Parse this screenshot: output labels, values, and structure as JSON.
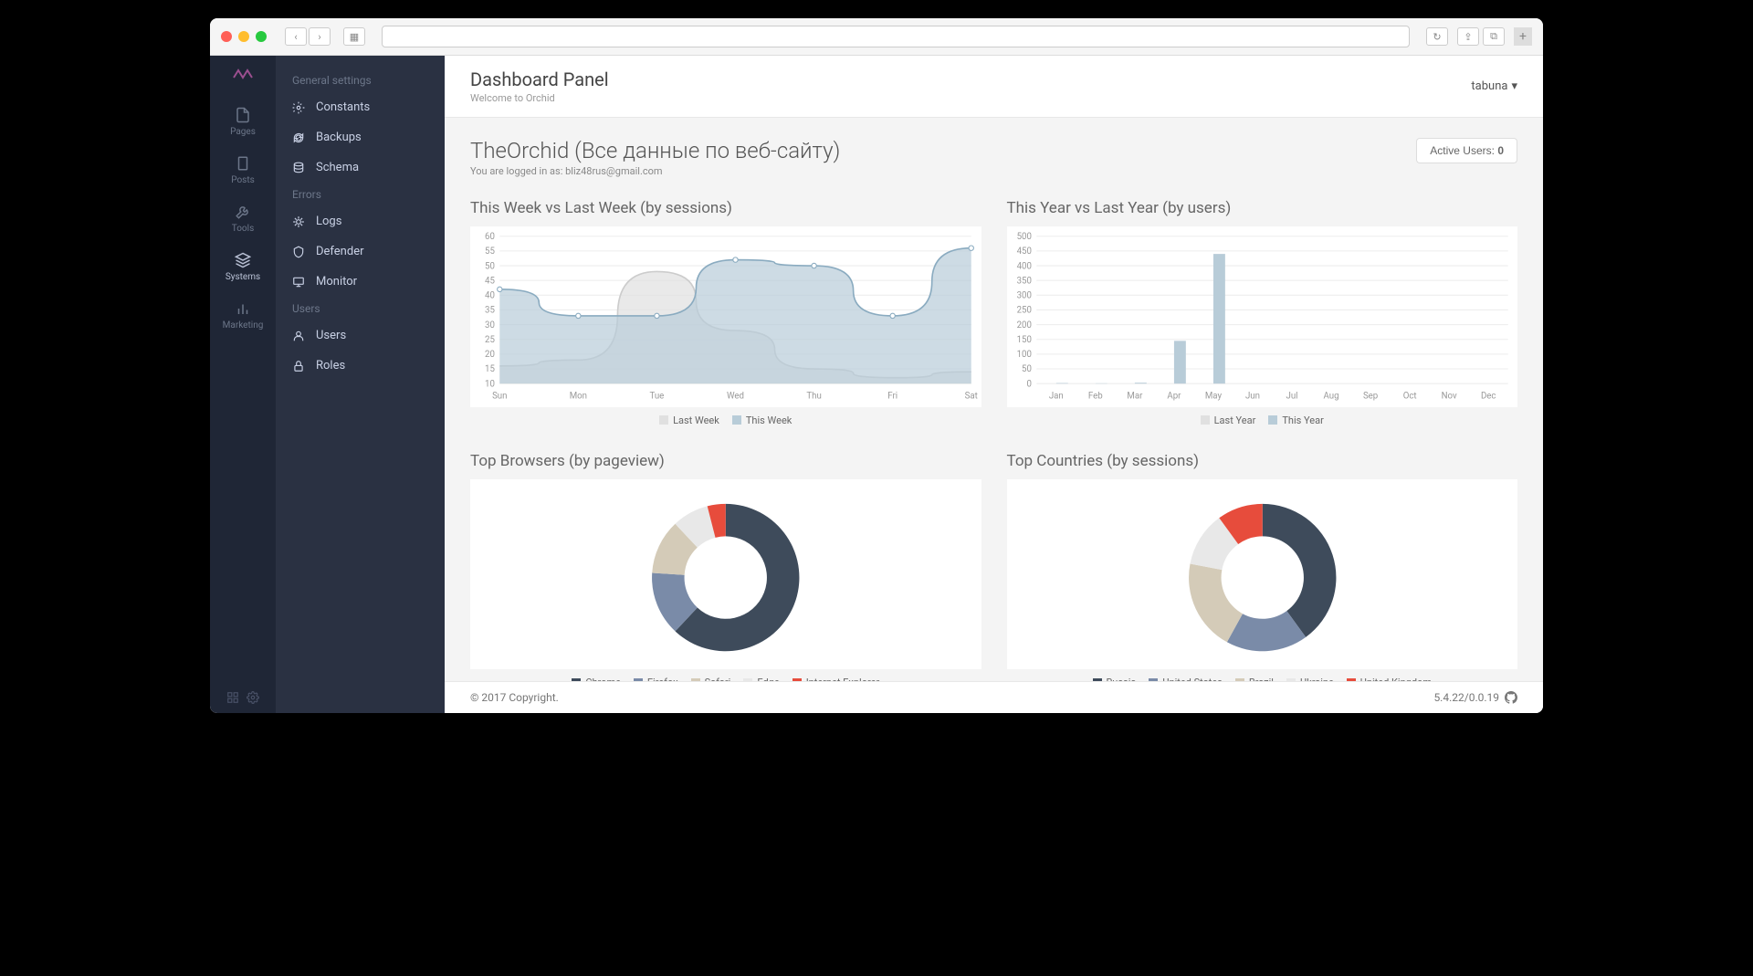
{
  "header": {
    "title": "Dashboard Panel",
    "subtitle": "Welcome to Orchid",
    "user": "tabuna"
  },
  "sidebar_dark": {
    "items": [
      {
        "id": "pages",
        "label": "Pages"
      },
      {
        "id": "posts",
        "label": "Posts"
      },
      {
        "id": "tools",
        "label": "Tools"
      },
      {
        "id": "systems",
        "label": "Systems",
        "active": true
      },
      {
        "id": "marketing",
        "label": "Marketing"
      }
    ]
  },
  "sidebar_sub": {
    "groups": [
      {
        "header": "General settings",
        "items": [
          {
            "icon": "gear",
            "label": "Constants"
          },
          {
            "icon": "refresh",
            "label": "Backups"
          },
          {
            "icon": "database",
            "label": "Schema"
          }
        ]
      },
      {
        "header": "Errors",
        "items": [
          {
            "icon": "bug",
            "label": "Logs"
          },
          {
            "icon": "shield",
            "label": "Defender"
          },
          {
            "icon": "monitor",
            "label": "Monitor"
          }
        ]
      },
      {
        "header": "Users",
        "items": [
          {
            "icon": "user",
            "label": "Users"
          },
          {
            "icon": "lock",
            "label": "Roles"
          }
        ]
      }
    ]
  },
  "page": {
    "title": "TheOrchid (Все данные по веб-сайту)",
    "subtitle": "You are logged in as: bliz48rus@gmail.com",
    "active_users_label": "Active Users:",
    "active_users_count": "0"
  },
  "footer": {
    "copyright": "© 2017 Copyright.",
    "version": "5.4.22/0.0.19"
  },
  "colors": {
    "dark_slate": "#3e4b5b",
    "blue_gray": "#7a8ba8",
    "beige": "#d4cbb8",
    "light_gray": "#e8e8e8",
    "red": "#e74c3c",
    "area_fill": "#b8ccd8",
    "area_line": "#8aabc0",
    "area2_fill": "#e0e0e0"
  },
  "chart_data": [
    {
      "id": "weekly",
      "type": "area",
      "title": "This Week vs Last Week (by sessions)",
      "categories": [
        "Sun",
        "Mon",
        "Tue",
        "Wed",
        "Thu",
        "Fri",
        "Sat"
      ],
      "series": [
        {
          "name": "Last Week",
          "values": [
            16,
            18,
            48,
            28,
            15,
            12,
            14
          ]
        },
        {
          "name": "This Week",
          "values": [
            42,
            33,
            33,
            52,
            50,
            33,
            56
          ]
        }
      ],
      "ylim": [
        10,
        60
      ],
      "yticks": [
        10,
        15,
        20,
        25,
        30,
        35,
        40,
        45,
        50,
        55,
        60
      ]
    },
    {
      "id": "yearly",
      "type": "bar",
      "title": "This Year vs Last Year (by users)",
      "categories": [
        "Jan",
        "Feb",
        "Mar",
        "Apr",
        "May",
        "Jun",
        "Jul",
        "Aug",
        "Sep",
        "Oct",
        "Nov",
        "Dec"
      ],
      "series": [
        {
          "name": "Last Year",
          "values": [
            0,
            0,
            0,
            0,
            0,
            0,
            0,
            0,
            0,
            0,
            0,
            0
          ]
        },
        {
          "name": "This Year",
          "values": [
            2,
            1,
            3,
            145,
            440,
            0,
            0,
            0,
            0,
            0,
            0,
            0
          ]
        }
      ],
      "ylim": [
        0,
        500
      ],
      "yticks": [
        0,
        50,
        100,
        150,
        200,
        250,
        300,
        350,
        400,
        450,
        500
      ]
    },
    {
      "id": "browsers",
      "type": "pie",
      "title": "Top Browsers (by pageview)",
      "series": [
        {
          "name": "Chrome",
          "value": 62,
          "color": "#3e4b5b"
        },
        {
          "name": "Firefox",
          "value": 14,
          "color": "#7a8ba8"
        },
        {
          "name": "Safari",
          "value": 12,
          "color": "#d4cbb8"
        },
        {
          "name": "Edge",
          "value": 8,
          "color": "#e8e8e8"
        },
        {
          "name": "Internet Explorer",
          "value": 4,
          "color": "#e74c3c"
        }
      ]
    },
    {
      "id": "countries",
      "type": "pie",
      "title": "Top Countries (by sessions)",
      "series": [
        {
          "name": "Russia",
          "value": 40,
          "color": "#3e4b5b"
        },
        {
          "name": "United States",
          "value": 18,
          "color": "#7a8ba8"
        },
        {
          "name": "Brazil",
          "value": 20,
          "color": "#d4cbb8"
        },
        {
          "name": "Ukraine",
          "value": 12,
          "color": "#e8e8e8"
        },
        {
          "name": "United Kingdom",
          "value": 10,
          "color": "#e74c3c"
        }
      ]
    }
  ]
}
